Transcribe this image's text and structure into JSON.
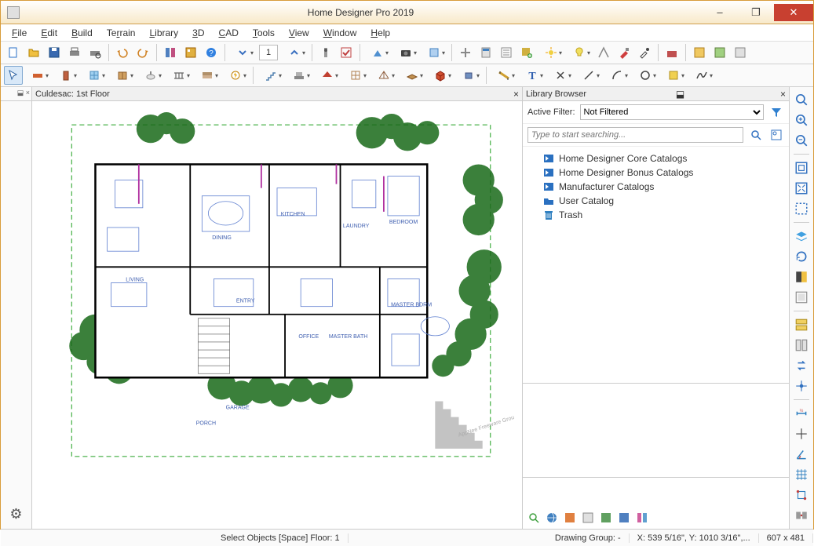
{
  "window": {
    "title": "Home Designer Pro 2019",
    "minimize": "–",
    "maximize": "❐",
    "close": "✕"
  },
  "menu": [
    "File",
    "Edit",
    "Build",
    "Terrain",
    "Library",
    "3D",
    "CAD",
    "Tools",
    "View",
    "Window",
    "Help"
  ],
  "toolbar_floor_value": "1",
  "document": {
    "tab_label": "Culdesac: 1st Floor"
  },
  "floorplan_rooms": [
    "LIVING",
    "DINING",
    "KITCHEN",
    "LAUNDRY",
    "BEDROOM",
    "OFFICE",
    "MASTER BATH",
    "MASTER BDRM",
    "GARAGE",
    "PORCH",
    "ENTRY"
  ],
  "library": {
    "title": "Library Browser",
    "filter_label": "Active Filter:",
    "filter_value": "Not Filtered",
    "search_placeholder": "Type to start searching...",
    "items": [
      {
        "icon": "catalog",
        "label": "Home Designer Core Catalogs"
      },
      {
        "icon": "catalog",
        "label": "Home Designer Bonus Catalogs"
      },
      {
        "icon": "catalog",
        "label": "Manufacturer Catalogs"
      },
      {
        "icon": "folder",
        "label": "User Catalog"
      },
      {
        "icon": "trash",
        "label": "Trash"
      }
    ]
  },
  "status": {
    "hint": "Select Objects [Space]  Floor: 1",
    "drawing_group": "Drawing Group: -",
    "coords": "X: 539 5/16\", Y: 1010 3/16\",...",
    "dims": "607 x 481"
  }
}
